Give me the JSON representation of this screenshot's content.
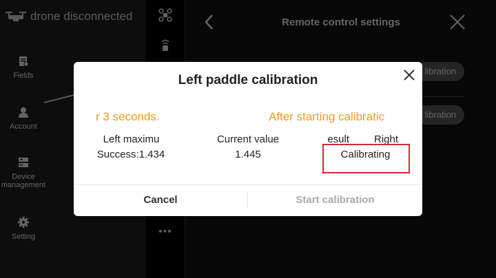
{
  "status": {
    "text": "drone disconnected"
  },
  "sidebar": {
    "items": [
      {
        "label": "Fields",
        "icon": "fields-icon"
      },
      {
        "label": "Account",
        "icon": "account-icon"
      },
      {
        "label": "Device management",
        "icon": "device-icon"
      },
      {
        "label": "Setting",
        "icon": "gear-icon"
      }
    ]
  },
  "header": {
    "title": "Remote control settings"
  },
  "background_buttons": [
    "libration",
    "libration"
  ],
  "dialog": {
    "title": "Left paddle calibration",
    "instruction_left": "r 3 seconds.",
    "instruction_right": "After starting calibratic",
    "columns": {
      "left_maximum": {
        "label": "Left maximu",
        "value": "Success:1.434"
      },
      "current_value": {
        "label": "Current value",
        "value": "1.445"
      },
      "result": {
        "label": "esult",
        "value": "Calibrating"
      },
      "right": {
        "label": "Right"
      }
    },
    "cancel_label": "Cancel",
    "start_label": "Start calibration"
  },
  "colors": {
    "accent_orange": "#f39a1c",
    "highlight_red": "#d8282f"
  }
}
